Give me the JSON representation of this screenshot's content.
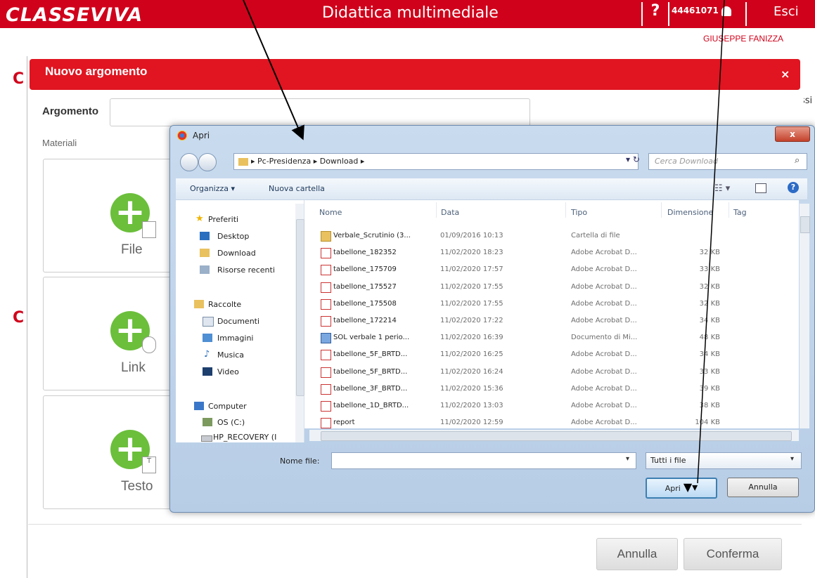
{
  "header": {
    "logo": "CLASSEVIVA",
    "app_title": "Didattica multimediale",
    "help": "?",
    "user_code": "44461071",
    "logout": "Esci",
    "user_name": "GIUSEPPE FANIZZA"
  },
  "background": {
    "letter_c": "C",
    "ssi_fragment": "ssi"
  },
  "modal": {
    "title": "Nuovo argomento",
    "close": "×",
    "argomento_label": "Argomento",
    "materiali_label": "Materiali",
    "cards": [
      {
        "label": "File",
        "badge": ""
      },
      {
        "label": "Link",
        "badge": ""
      },
      {
        "label": "Testo",
        "badge": "T"
      }
    ],
    "cancel": "Annulla",
    "confirm": "Conferma"
  },
  "dialog": {
    "title": "Apri",
    "close": "x",
    "path": [
      "Pc-Presidenza",
      "Download"
    ],
    "search_placeholder": "Cerca Download",
    "organize": "Organizza ▾",
    "new_folder": "Nuova cartella",
    "nav": {
      "favorites_header": "Preferiti",
      "favorites": [
        "Desktop",
        "Download",
        "Risorse recenti"
      ],
      "libraries_header": "Raccolte",
      "libraries": [
        "Documenti",
        "Immagini",
        "Musica",
        "Video"
      ],
      "computer_header": "Computer",
      "computer": [
        "OS (C:)",
        "HP_RECOVERY (I"
      ]
    },
    "columns": [
      "Nome",
      "Data",
      "Tipo",
      "Dimensione",
      "Tag"
    ],
    "files": [
      {
        "name": "Verbale_Scrutinio (3...",
        "date": "01/09/2016 10:13",
        "type": "Cartella di file",
        "size": "",
        "icon": "folder"
      },
      {
        "name": "tabellone_182352",
        "date": "11/02/2020 18:23",
        "type": "Adobe Acrobat D...",
        "size": "32 KB",
        "icon": "pdf"
      },
      {
        "name": "tabellone_175709",
        "date": "11/02/2020 17:57",
        "type": "Adobe Acrobat D...",
        "size": "33 KB",
        "icon": "pdf"
      },
      {
        "name": "tabellone_175527",
        "date": "11/02/2020 17:55",
        "type": "Adobe Acrobat D...",
        "size": "32 KB",
        "icon": "pdf"
      },
      {
        "name": "tabellone_175508",
        "date": "11/02/2020 17:55",
        "type": "Adobe Acrobat D...",
        "size": "32 KB",
        "icon": "pdf"
      },
      {
        "name": "tabellone_172214",
        "date": "11/02/2020 17:22",
        "type": "Adobe Acrobat D...",
        "size": "34 KB",
        "icon": "pdf"
      },
      {
        "name": "SOL verbale 1 perio...",
        "date": "11/02/2020 16:39",
        "type": "Documento di Mi...",
        "size": "48 KB",
        "icon": "doc"
      },
      {
        "name": "tabellone_5F_BRTD...",
        "date": "11/02/2020 16:25",
        "type": "Adobe Acrobat D...",
        "size": "34 KB",
        "icon": "pdf"
      },
      {
        "name": "tabellone_5F_BRTD...",
        "date": "11/02/2020 16:24",
        "type": "Adobe Acrobat D...",
        "size": "33 KB",
        "icon": "pdf"
      },
      {
        "name": "tabellone_3F_BRTD...",
        "date": "11/02/2020 15:36",
        "type": "Adobe Acrobat D...",
        "size": "39 KB",
        "icon": "pdf"
      },
      {
        "name": "tabellone_1D_BRTD...",
        "date": "11/02/2020 13:03",
        "type": "Adobe Acrobat D...",
        "size": "38 KB",
        "icon": "pdf"
      },
      {
        "name": "report",
        "date": "11/02/2020 12:59",
        "type": "Adobe Acrobat D...",
        "size": "104 KB",
        "icon": "pdf"
      }
    ],
    "filename_label": "Nome file:",
    "filename_value": "",
    "filter": "Tutti i file",
    "open": "Apri",
    "cancel": "Annulla"
  },
  "colors": {
    "brand_red": "#d0021b",
    "plus_green": "#6bbf3b"
  }
}
